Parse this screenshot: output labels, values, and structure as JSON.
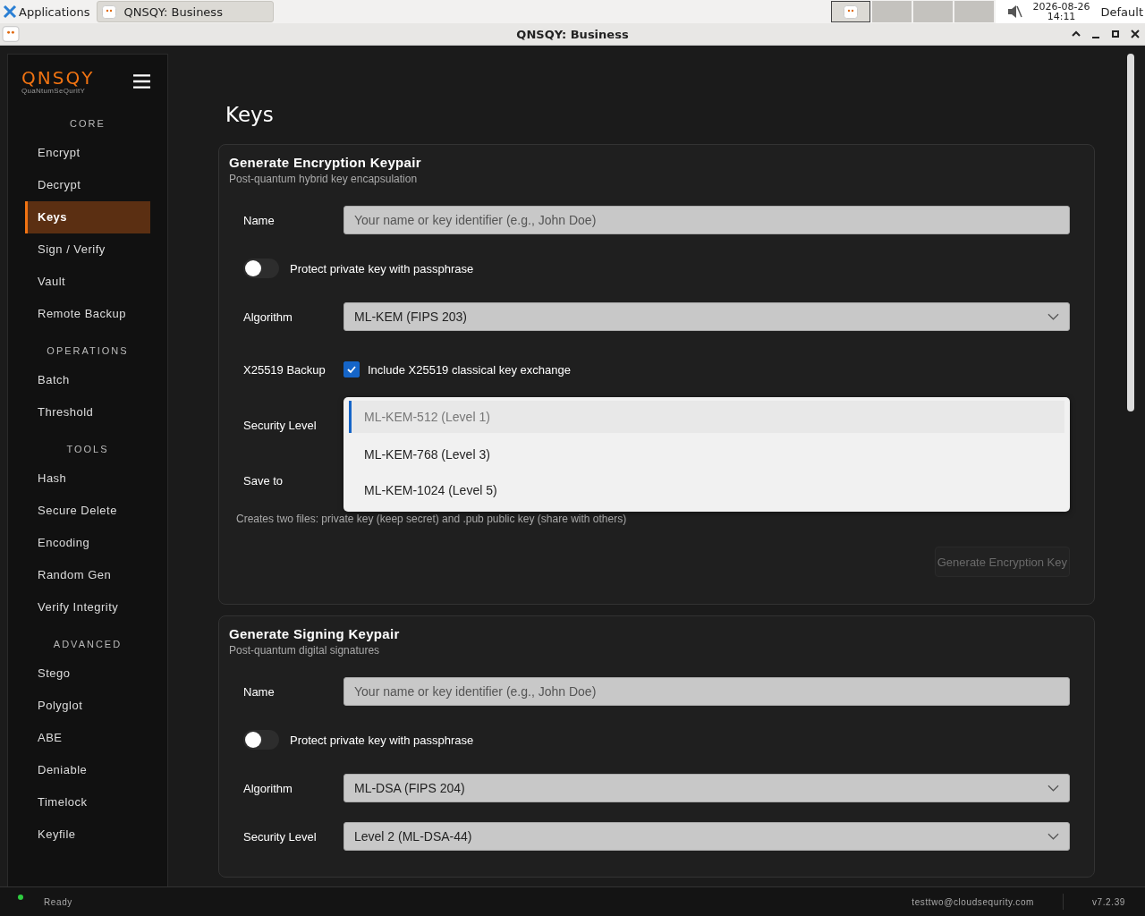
{
  "taskbar": {
    "apps_label": "Applications",
    "task": "QNSQY: Business",
    "clock_date": "2026-08-26",
    "clock_time": "14:11",
    "layout": "Default"
  },
  "window": {
    "title": "QNSQY: Business"
  },
  "sidebar": {
    "logo": "QNSQY",
    "tagline": "QuaNtumSeQuritY",
    "sections": [
      {
        "title": "CORE",
        "items": [
          {
            "label": "Encrypt",
            "selected": false
          },
          {
            "label": "Decrypt",
            "selected": false
          },
          {
            "label": "Keys",
            "selected": true
          },
          {
            "label": "Sign / Verify",
            "selected": false
          },
          {
            "label": "Vault",
            "selected": false
          },
          {
            "label": "Remote Backup",
            "selected": false
          }
        ]
      },
      {
        "title": "OPERATIONS",
        "items": [
          {
            "label": "Batch",
            "selected": false
          },
          {
            "label": "Threshold",
            "selected": false
          }
        ]
      },
      {
        "title": "TOOLS",
        "items": [
          {
            "label": "Hash",
            "selected": false
          },
          {
            "label": "Secure Delete",
            "selected": false
          },
          {
            "label": "Encoding",
            "selected": false
          },
          {
            "label": "Random Gen",
            "selected": false
          },
          {
            "label": "Verify Integrity",
            "selected": false
          }
        ]
      },
      {
        "title": "ADVANCED",
        "items": [
          {
            "label": "Stego",
            "selected": false
          },
          {
            "label": "Polyglot",
            "selected": false
          },
          {
            "label": "ABE",
            "selected": false
          },
          {
            "label": "Deniable",
            "selected": false
          },
          {
            "label": "Timelock",
            "selected": false
          },
          {
            "label": "Keyfile",
            "selected": false
          }
        ]
      }
    ]
  },
  "page_title": "Keys",
  "cards": [
    {
      "title": "Generate Encryption Keypair",
      "subtitle": "Post-quantum hybrid key encapsulation",
      "rows": [
        {
          "kind": "text",
          "label": "Name",
          "placeholder": "Your name or key identifier (e.g., John Doe)"
        },
        {
          "kind": "toggle",
          "label": "Protect private key with passphrase",
          "on": false
        },
        {
          "kind": "select",
          "label": "Algorithm",
          "value": "ML-KEM (FIPS 203)"
        },
        {
          "kind": "checkbox",
          "label": "X25519 Backup",
          "text": "Include X25519 classical key exchange",
          "checked": true
        },
        {
          "kind": "open_select",
          "label": "Security Level",
          "options": [
            {
              "label": "ML-KEM-512 (Level 1)",
              "selected": true
            },
            {
              "label": "ML-KEM-768 (Level 3)",
              "selected": false
            },
            {
              "label": "ML-KEM-1024 (Level 5)",
              "selected": false
            }
          ]
        },
        {
          "kind": "covered",
          "label": "Save to"
        }
      ],
      "note": "Creates two files: private key (keep secret) and .pub public key (share with others)",
      "button": "Generate Encryption Key"
    },
    {
      "title": "Generate Signing Keypair",
      "subtitle": "Post-quantum digital signatures",
      "rows": [
        {
          "kind": "text",
          "label": "Name",
          "placeholder": "Your name or key identifier (e.g., John Doe)"
        },
        {
          "kind": "toggle",
          "label": "Protect private key with passphrase",
          "on": false
        },
        {
          "kind": "select",
          "label": "Algorithm",
          "value": "ML-DSA (FIPS 204)"
        },
        {
          "kind": "select",
          "label": "Security Level",
          "value": "Level 2 (ML-DSA-44)"
        }
      ]
    }
  ],
  "status_bar": {
    "status": "Ready",
    "user": "testtwo@cloudsequrity.com",
    "version": "v7.2.39"
  }
}
